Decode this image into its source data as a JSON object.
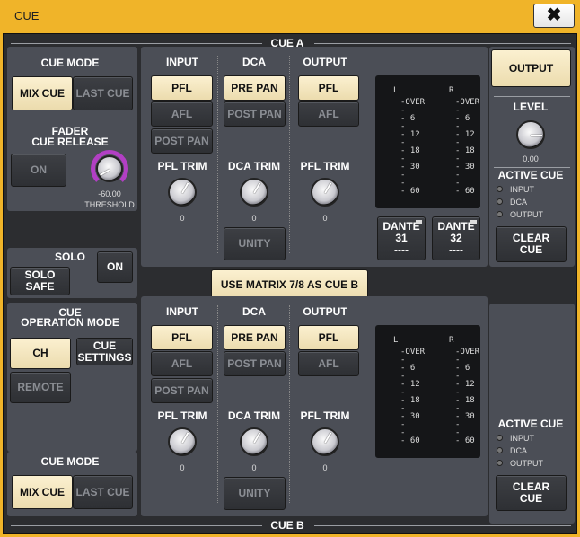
{
  "window": {
    "title": "CUE",
    "close_icon": "close-icon"
  },
  "colors": {
    "title_bar": "#f0b429",
    "button_on": "#f1e2b8",
    "panel": "#4b4e56",
    "threshold_ring": "#b23fc4"
  },
  "cue_a": {
    "title": "CUE A",
    "cue_mode": {
      "label": "CUE MODE",
      "mix": "MIX CUE",
      "last": "LAST CUE",
      "selected": "MIX CUE"
    },
    "fader_cue_release": {
      "label1": "FADER",
      "label2": "CUE RELEASE",
      "on": "ON",
      "threshold_value": "-60.00",
      "threshold_label": "THRESHOLD"
    },
    "input": {
      "label": "INPUT",
      "pfl": "PFL",
      "afl": "AFL",
      "post_pan": "POST PAN",
      "trim_label": "PFL TRIM",
      "trim_value": "0",
      "selected": "PFL"
    },
    "dca": {
      "label": "DCA",
      "pre_pan": "PRE PAN",
      "post_pan": "POST PAN",
      "trim_label": "DCA TRIM",
      "trim_value": "0",
      "unity": "UNITY",
      "selected": "PRE PAN"
    },
    "output": {
      "label": "OUTPUT",
      "pfl": "PFL",
      "afl": "AFL",
      "trim_label": "PFL TRIM",
      "trim_value": "0",
      "selected": "PFL"
    },
    "meter": {
      "l": "L",
      "r": "R",
      "scale": [
        "-OVER",
        "-",
        "- 6",
        "-",
        "- 12",
        "-",
        "- 18",
        "-",
        "- 30",
        "-",
        "-",
        "- 60"
      ]
    },
    "dante": [
      {
        "name": "DANTE",
        "num": "31",
        "value": "----"
      },
      {
        "name": "DANTE",
        "num": "32",
        "value": "----"
      }
    ],
    "right": {
      "output": "OUTPUT",
      "level_label": "LEVEL",
      "level_value": "0.00",
      "active_cue": "ACTIVE CUE",
      "leds": [
        "INPUT",
        "DCA",
        "OUTPUT"
      ],
      "clear": "CLEAR\nCUE"
    }
  },
  "matrix_button": "USE MATRIX 7/8 AS CUE B",
  "solo": {
    "label": "SOLO",
    "on": "ON",
    "safe": "SOLO\nSAFE"
  },
  "cue_operation_mode": {
    "label1": "CUE",
    "label2": "OPERATION MODE",
    "ch": "CH",
    "settings": "CUE\nSETTINGS",
    "remote": "REMOTE"
  },
  "cue_b": {
    "title": "CUE B",
    "cue_mode": {
      "label": "CUE MODE",
      "mix": "MIX CUE",
      "last": "LAST CUE",
      "selected": "MIX CUE"
    },
    "input": {
      "label": "INPUT",
      "pfl": "PFL",
      "afl": "AFL",
      "post_pan": "POST PAN",
      "trim_label": "PFL TRIM",
      "trim_value": "0",
      "selected": "PFL"
    },
    "dca": {
      "label": "DCA",
      "pre_pan": "PRE PAN",
      "post_pan": "POST PAN",
      "trim_label": "DCA TRIM",
      "trim_value": "0",
      "unity": "UNITY",
      "selected": "PRE PAN"
    },
    "output": {
      "label": "OUTPUT",
      "pfl": "PFL",
      "afl": "AFL",
      "trim_label": "PFL TRIM",
      "trim_value": "0",
      "selected": "PFL"
    },
    "meter": {
      "l": "L",
      "r": "R",
      "scale": [
        "-OVER",
        "-",
        "- 6",
        "-",
        "- 12",
        "-",
        "- 18",
        "-",
        "- 30",
        "-",
        "-",
        "- 60"
      ]
    },
    "right": {
      "active_cue": "ACTIVE CUE",
      "leds": [
        "INPUT",
        "DCA",
        "OUTPUT"
      ],
      "clear": "CLEAR\nCUE"
    }
  }
}
